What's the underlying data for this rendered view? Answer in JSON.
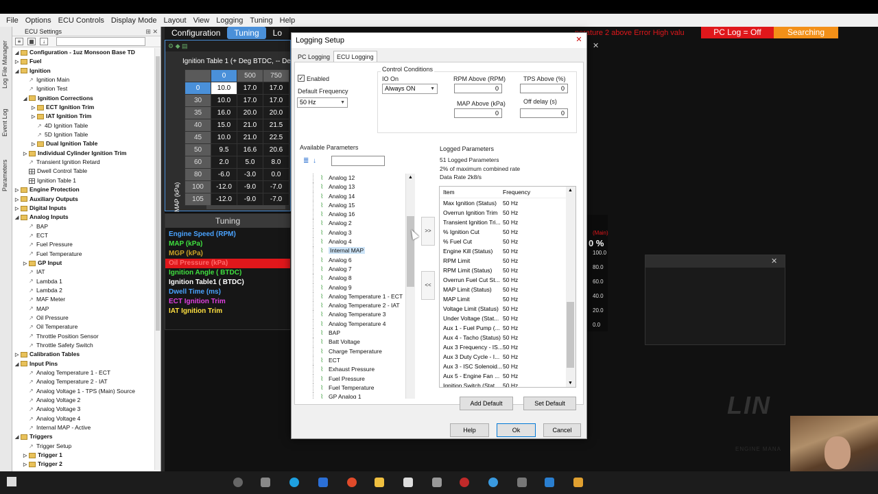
{
  "menu": [
    "File",
    "Options",
    "ECU Controls",
    "Display Mode",
    "Layout",
    "View",
    "Logging",
    "Tuning",
    "Help"
  ],
  "side_tabs": [
    "Log File Manager",
    "Event Log",
    "Parameters"
  ],
  "ecu_panel": {
    "title": "ECU Settings",
    "tree": [
      {
        "label": "Configuration - 1uz Monsoon Base TD",
        "level": 0,
        "type": "folder",
        "bold": true,
        "twisty": "◢"
      },
      {
        "label": "Fuel",
        "level": 0,
        "type": "folder",
        "bold": true,
        "twisty": "▷"
      },
      {
        "label": "Ignition",
        "level": 0,
        "type": "folder",
        "bold": true,
        "twisty": "◢"
      },
      {
        "label": "Ignition Main",
        "level": 1,
        "type": "leaf"
      },
      {
        "label": "Ignition Test",
        "level": 1,
        "type": "leaf"
      },
      {
        "label": "Ignition Corrections",
        "level": 1,
        "type": "folder",
        "bold": true,
        "twisty": "◢"
      },
      {
        "label": "ECT Ignition Trim",
        "level": 2,
        "type": "folder",
        "bold": true,
        "twisty": "▷"
      },
      {
        "label": "IAT Ignition Trim",
        "level": 2,
        "type": "folder",
        "bold": true,
        "twisty": "▷"
      },
      {
        "label": "4D Ignition Table",
        "level": 2,
        "type": "leaf"
      },
      {
        "label": "5D Ignition Table",
        "level": 2,
        "type": "leaf"
      },
      {
        "label": "Dual Ignition Table",
        "level": 2,
        "type": "folder",
        "bold": true,
        "twisty": "▷"
      },
      {
        "label": "Individual Cylinder Ignition Trim",
        "level": 1,
        "type": "folder",
        "bold": true,
        "twisty": "▷"
      },
      {
        "label": "Transient Ignition Retard",
        "level": 1,
        "type": "leaf"
      },
      {
        "label": "Dwell Control Table",
        "level": 1,
        "type": "grid"
      },
      {
        "label": "Ignition Table 1",
        "level": 1,
        "type": "grid"
      },
      {
        "label": "Engine Protection",
        "level": 0,
        "type": "folder",
        "bold": true,
        "twisty": "▷"
      },
      {
        "label": "Auxiliary Outputs",
        "level": 0,
        "type": "folder",
        "bold": true,
        "twisty": "▷"
      },
      {
        "label": "Digital Inputs",
        "level": 0,
        "type": "folder",
        "bold": true,
        "twisty": "▷"
      },
      {
        "label": "Analog Inputs",
        "level": 0,
        "type": "folder",
        "bold": true,
        "twisty": "◢"
      },
      {
        "label": "BAP",
        "level": 1,
        "type": "leaf"
      },
      {
        "label": "ECT",
        "level": 1,
        "type": "leaf"
      },
      {
        "label": "Fuel Pressure",
        "level": 1,
        "type": "leaf"
      },
      {
        "label": "Fuel Temperature",
        "level": 1,
        "type": "leaf"
      },
      {
        "label": "GP Input",
        "level": 1,
        "type": "folder",
        "bold": true,
        "twisty": "▷"
      },
      {
        "label": "IAT",
        "level": 1,
        "type": "leaf"
      },
      {
        "label": "Lambda 1",
        "level": 1,
        "type": "leaf"
      },
      {
        "label": "Lambda 2",
        "level": 1,
        "type": "leaf"
      },
      {
        "label": "MAF Meter",
        "level": 1,
        "type": "leaf"
      },
      {
        "label": "MAP",
        "level": 1,
        "type": "leaf"
      },
      {
        "label": "Oil Pressure",
        "level": 1,
        "type": "leaf"
      },
      {
        "label": "Oil Temperature",
        "level": 1,
        "type": "leaf"
      },
      {
        "label": "Throttle Position Sensor",
        "level": 1,
        "type": "leaf"
      },
      {
        "label": "Throttle Safety Switch",
        "level": 1,
        "type": "leaf"
      },
      {
        "label": "Calibration Tables",
        "level": 0,
        "type": "folder",
        "bold": true,
        "twisty": "▷"
      },
      {
        "label": "Input Pins",
        "level": 0,
        "type": "folder",
        "bold": true,
        "twisty": "◢"
      },
      {
        "label": "Analog Temperature 1 - ECT",
        "level": 1,
        "type": "leaf"
      },
      {
        "label": "Analog Temperature 2 - IAT",
        "level": 1,
        "type": "leaf"
      },
      {
        "label": "Analog Voltage 1 - TPS (Main) Source",
        "level": 1,
        "type": "leaf"
      },
      {
        "label": "Analog Voltage 2",
        "level": 1,
        "type": "leaf"
      },
      {
        "label": "Analog Voltage 3",
        "level": 1,
        "type": "leaf"
      },
      {
        "label": "Analog Voltage 4",
        "level": 1,
        "type": "leaf"
      },
      {
        "label": "Internal MAP - Active",
        "level": 1,
        "type": "leaf"
      },
      {
        "label": "Triggers",
        "level": 0,
        "type": "folder",
        "bold": true,
        "twisty": "◢"
      },
      {
        "label": "Trigger Setup",
        "level": 1,
        "type": "leaf"
      },
      {
        "label": "Trigger 1",
        "level": 1,
        "type": "folder",
        "bold": true,
        "twisty": "▷"
      },
      {
        "label": "Trigger 2",
        "level": 1,
        "type": "folder",
        "bold": true,
        "twisty": "▷"
      }
    ]
  },
  "workspace_tabs": [
    "Configuration",
    "Tuning",
    "Lo"
  ],
  "status": {
    "alert_text": "perature 2 above Error High valu",
    "pc_log": "PC Log = Off",
    "searching": "Searching"
  },
  "ignition_table": {
    "title": "Ignition Table 1 (+ Deg BTDC, -- De",
    "y_axis_label": "MAP (kPa)",
    "col_headers": [
      "0",
      "500",
      "750"
    ],
    "rows": [
      {
        "map": "0",
        "vals": [
          "10.0",
          "17.0",
          "17.0"
        ]
      },
      {
        "map": "30",
        "vals": [
          "10.0",
          "17.0",
          "17.0"
        ]
      },
      {
        "map": "35",
        "vals": [
          "16.0",
          "20.0",
          "20.0"
        ]
      },
      {
        "map": "40",
        "vals": [
          "15.0",
          "21.0",
          "21.5"
        ]
      },
      {
        "map": "45",
        "vals": [
          "10.0",
          "21.0",
          "22.5"
        ]
      },
      {
        "map": "50",
        "vals": [
          "9.5",
          "16.6",
          "20.6"
        ]
      },
      {
        "map": "60",
        "vals": [
          "2.0",
          "5.0",
          "8.0"
        ]
      },
      {
        "map": "80",
        "vals": [
          "-6.0",
          "-3.0",
          "0.0"
        ]
      },
      {
        "map": "100",
        "vals": [
          "-12.0",
          "-9.0",
          "-7.0"
        ]
      },
      {
        "map": "105",
        "vals": [
          "-12.0",
          "-9.0",
          "-7.0"
        ]
      }
    ]
  },
  "tuning": {
    "title": "Tuning",
    "items": [
      {
        "label": "Engine Speed (RPM)",
        "color": "#4aa3ff",
        "bg": "transparent"
      },
      {
        "label": "MAP (kPa)",
        "color": "#3fe03f",
        "bg": "transparent"
      },
      {
        "label": "MGP (kPa)",
        "color": "#c9a227",
        "bg": "transparent"
      },
      {
        "label": "Oil Pressure (kPa)",
        "color": "#ff6b6b",
        "bg": "#e0171b"
      },
      {
        "label": "Ignition Angle ( BTDC)",
        "color": "#3fe03f",
        "bg": "transparent"
      },
      {
        "label": "Ignition Table1 ( BTDC)",
        "color": "#ffffff",
        "bg": "transparent"
      },
      {
        "label": "Dwell Time (ms)",
        "color": "#4aa3ff",
        "bg": "transparent"
      },
      {
        "label": "ECT Ignition Trim",
        "color": "#e040e0",
        "bg": "transparent"
      },
      {
        "label": "IAT Ignition Trim",
        "color": "#ffe040",
        "bg": "transparent"
      }
    ]
  },
  "gauge": {
    "label": "(Main)",
    "value": "0 %",
    "ticks": [
      "100.0",
      "80.0",
      "60.0",
      "40.0",
      "20.0",
      "0.0"
    ]
  },
  "logo": {
    "text": "LIN",
    "sub": "ENGINE MANA"
  },
  "dialog": {
    "title": "Logging Setup",
    "tabs": [
      "PC Logging",
      "ECU Logging"
    ],
    "enabled_label": "Enabled",
    "default_freq_label": "Default Frequency",
    "default_freq_value": "50 Hz",
    "control_conditions": "Control Conditions",
    "io_on_label": "IO On",
    "io_on_value": "Always ON",
    "rpm_above_label": "RPM Above (RPM)",
    "rpm_above_value": "0",
    "tps_above_label": "TPS Above (%)",
    "tps_above_value": "0",
    "map_above_label": "MAP Above (kPa)",
    "map_above_value": "0",
    "off_delay_label": "Off delay (s)",
    "off_delay_value": "0",
    "available_label": "Available Parameters",
    "available_items": [
      "Analog 12",
      "Analog 13",
      "Analog 14",
      "Analog 15",
      "Analog 16",
      "Analog 2",
      "Analog 3",
      "Analog 4",
      "Internal MAP",
      "Analog 6",
      "Analog 7",
      "Analog 8",
      "Analog 9",
      "Analog Temperature 1 - ECT",
      "Analog Temperature 2 - IAT",
      "Analog Temperature 3",
      "Analog Temperature 4",
      "BAP",
      "Batt Voltage",
      "Charge Temperature",
      "ECT",
      "Exhaust Pressure",
      "Fuel Pressure",
      "Fuel Temperature",
      "GP Analog 1"
    ],
    "selected_available": "Internal MAP",
    "logged_label": "Logged Parameters",
    "logged_count": "51 Logged Parameters",
    "logged_rate": "2% of maximum combined rate",
    "logged_data_rate": "Data Rate 2k8/s",
    "log_headers": {
      "item": "Item",
      "freq": "Frequency"
    },
    "logged_items": [
      {
        "item": "Max Ignition (Status)",
        "freq": "50 Hz"
      },
      {
        "item": "Overrun Ignition Trim",
        "freq": "50 Hz"
      },
      {
        "item": "Transient Ignition Tri...",
        "freq": "50 Hz"
      },
      {
        "item": "% Ignition Cut",
        "freq": "50 Hz"
      },
      {
        "item": "% Fuel Cut",
        "freq": "50 Hz"
      },
      {
        "item": "Engine Kill (Status)",
        "freq": "50 Hz"
      },
      {
        "item": "RPM Limit",
        "freq": "50 Hz"
      },
      {
        "item": "RPM Limit (Status)",
        "freq": "50 Hz"
      },
      {
        "item": "Overrun Fuel Cut St...",
        "freq": "50 Hz"
      },
      {
        "item": "MAP Limit (Status)",
        "freq": "50 Hz"
      },
      {
        "item": "MAP Limit",
        "freq": "50 Hz"
      },
      {
        "item": "Voltage Limit (Status)",
        "freq": "50 Hz"
      },
      {
        "item": "Under Voltage (Stat...",
        "freq": "50 Hz"
      },
      {
        "item": "Aux 1 - Fuel Pump (...",
        "freq": "50 Hz"
      },
      {
        "item": "Aux 4 - Tacho (Status)",
        "freq": "50 Hz"
      },
      {
        "item": "Aux 3 Frequency - IS...",
        "freq": "50 Hz"
      },
      {
        "item": "Aux 3 Duty Cycle - I...",
        "freq": "50 Hz"
      },
      {
        "item": "Aux 3 - ISC Solenoid...",
        "freq": "50 Hz"
      },
      {
        "item": "Aux 5 - Engine Fan ...",
        "freq": "50 Hz"
      },
      {
        "item": "Ignition Switch (Stat...",
        "freq": "50 Hz"
      }
    ],
    "add_arrow": ">>",
    "remove_arrow": "<<",
    "add_default": "Add Default",
    "set_default": "Set Default",
    "help": "Help",
    "ok": "Ok",
    "cancel": "Cancel"
  }
}
